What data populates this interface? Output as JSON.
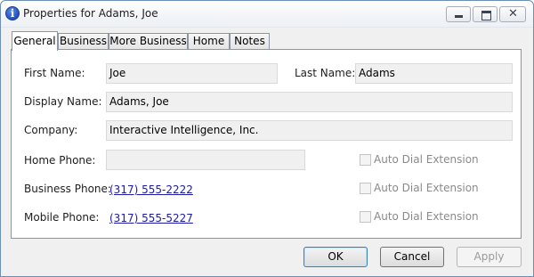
{
  "window": {
    "title": "Properties for Adams, Joe",
    "title_icon": "info-icon",
    "minimize_icon": "minimize-icon",
    "maximize_icon": "maximize-icon",
    "close_label": "✕"
  },
  "tabs": [
    {
      "label": "General",
      "active": true
    },
    {
      "label": "Business",
      "active": false
    },
    {
      "label": "More Business",
      "active": false
    },
    {
      "label": "Home",
      "active": false
    },
    {
      "label": "Notes",
      "active": false
    }
  ],
  "general": {
    "first_name_label": "First Name:",
    "first_name_value": "Joe",
    "last_name_label": "Last Name:",
    "last_name_value": "Adams",
    "display_name_label": "Display Name:",
    "display_name_value": "Adams, Joe",
    "company_label": "Company:",
    "company_value": "Interactive Intelligence, Inc.",
    "home_phone_label": "Home Phone:",
    "home_phone_value": "",
    "business_phone_label": "Business Phone:",
    "business_phone_value": "(317) 555-2222",
    "mobile_phone_label": "Mobile Phone:",
    "mobile_phone_value": "(317) 555-5227",
    "auto_dial_label": "Auto Dial Extension"
  },
  "buttons": {
    "ok": "OK",
    "cancel": "Cancel",
    "apply": "Apply"
  }
}
